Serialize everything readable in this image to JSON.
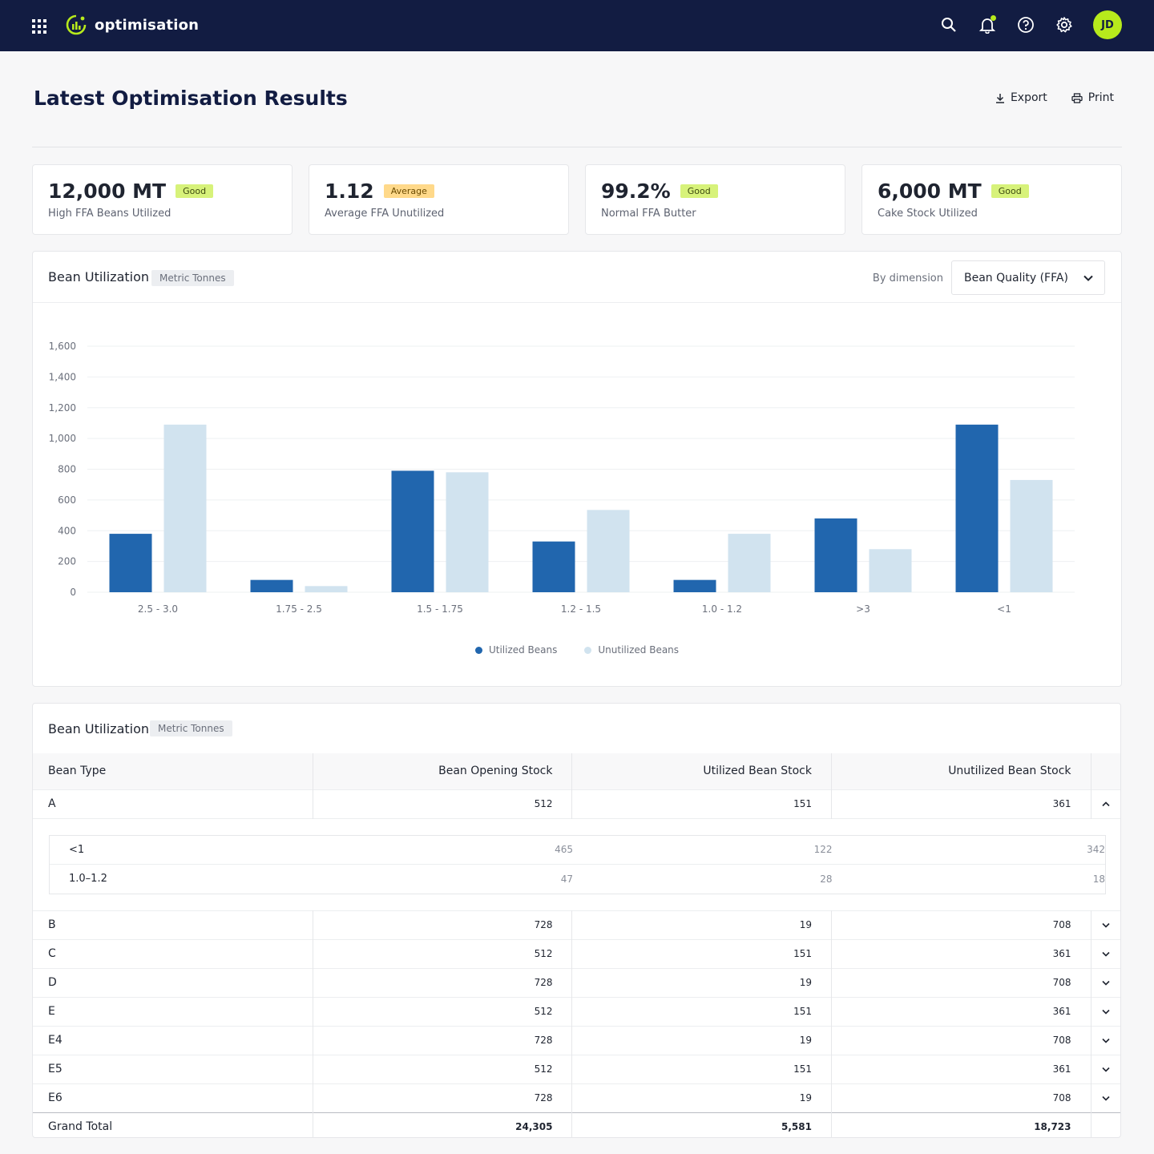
{
  "app": {
    "name": "optimisation",
    "user_initials": "JD"
  },
  "header": {
    "title": "Latest Optimisation Results",
    "export_label": "Export",
    "print_label": "Print"
  },
  "kpis": [
    {
      "value": "12,000 MT",
      "badge": "Good",
      "label": "High FFA Beans Utilized"
    },
    {
      "value": "1.12",
      "badge": "Average",
      "label": "Average FFA Unutilized"
    },
    {
      "value": "99.2%",
      "badge": "Good",
      "label": "Normal FFA Butter"
    },
    {
      "value": "6,000 MT",
      "badge": "Good",
      "label": "Cake Stock Utilized"
    }
  ],
  "chart_panel": {
    "title": "Bean Utilization",
    "unit": "Metric Tonnes",
    "dimension_label": "By dimension",
    "dimension_value": "Bean Quality (FFA)"
  },
  "chart_data": {
    "type": "bar",
    "categories": [
      "2.5 - 3.0",
      "1.75 - 2.5",
      "1.5 - 1.75",
      "1.2 - 1.5",
      "1.0 - 1.2",
      ">3",
      "<1"
    ],
    "series": [
      {
        "name": "Utilized Beans",
        "values": [
          380,
          80,
          790,
          330,
          80,
          480,
          1090
        ],
        "color": "#2166ae"
      },
      {
        "name": "Unutilized Beans",
        "values": [
          1090,
          40,
          780,
          535,
          380,
          280,
          730
        ],
        "color": "#d1e3ef"
      }
    ],
    "yticks": [
      "0",
      "200",
      "400",
      "600",
      "800",
      "1,000",
      "1,200",
      "1,400",
      "1,600"
    ],
    "ylim": [
      0,
      1600
    ],
    "grid": true,
    "legend_position": "bottom-center"
  },
  "table_panel": {
    "title": "Bean Utilization",
    "unit": "Metric Tonnes",
    "columns": [
      "Bean Type",
      "Bean Opening Stock",
      "Utilized Bean Stock",
      "Unutilized Bean Stock"
    ],
    "expanded_row": {
      "name": "A",
      "opening": "512",
      "utilized": "151",
      "unutilized": "361",
      "children": [
        {
          "name": "<1",
          "opening": "465",
          "utilized": "122",
          "unutilized": "342"
        },
        {
          "name": "1.0–1.2",
          "opening": "47",
          "utilized": "28",
          "unutilized": "18"
        }
      ]
    },
    "rows": [
      {
        "name": "B",
        "opening": "728",
        "utilized": "19",
        "unutilized": "708"
      },
      {
        "name": "C",
        "opening": "512",
        "utilized": "151",
        "unutilized": "361"
      },
      {
        "name": "D",
        "opening": "728",
        "utilized": "19",
        "unutilized": "708"
      },
      {
        "name": "E",
        "opening": "512",
        "utilized": "151",
        "unutilized": "361"
      },
      {
        "name": "E4",
        "opening": "728",
        "utilized": "19",
        "unutilized": "708"
      },
      {
        "name": "E5",
        "opening": "512",
        "utilized": "151",
        "unutilized": "361"
      },
      {
        "name": "E6",
        "opening": "728",
        "utilized": "19",
        "unutilized": "708"
      }
    ],
    "total": {
      "name": "Grand Total",
      "opening": "24,305",
      "utilized": "5,581",
      "unutilized": "18,723"
    }
  }
}
